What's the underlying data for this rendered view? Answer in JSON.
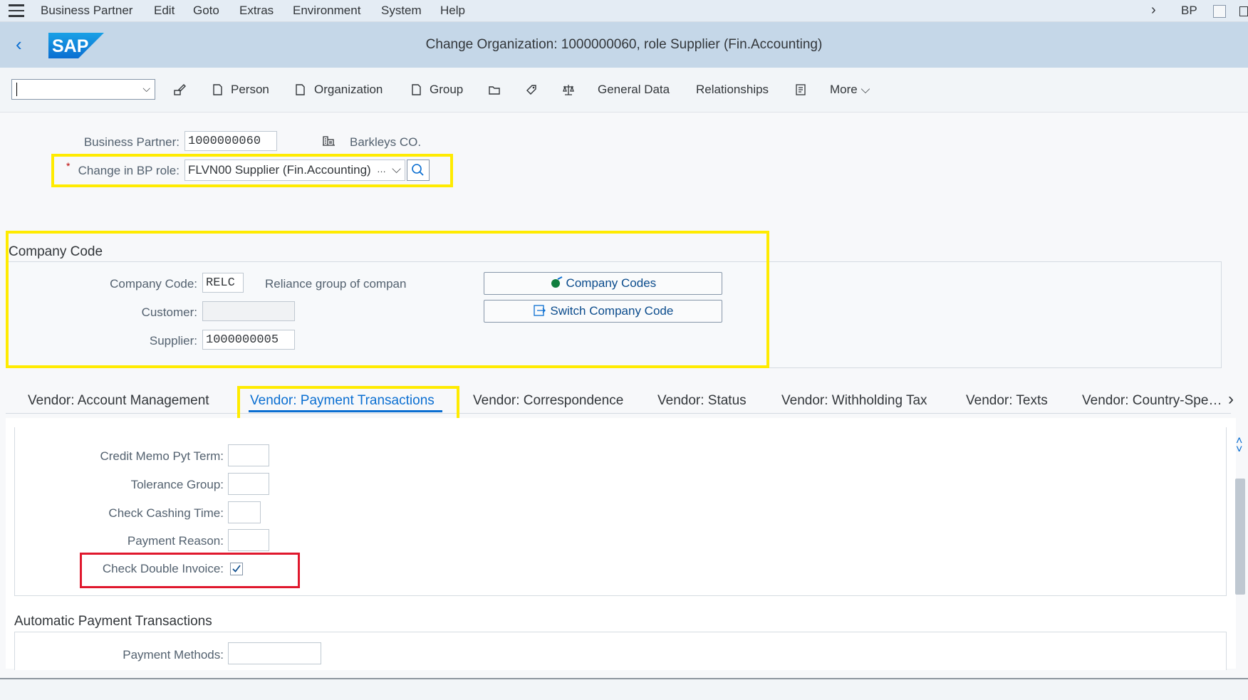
{
  "menu": {
    "items": [
      "Business Partner",
      "Edit",
      "Goto",
      "Extras",
      "Environment",
      "System",
      "Help"
    ],
    "right_label": "BP"
  },
  "header": {
    "title": "Change Organization: 1000000060, role Supplier (Fin.Accounting)",
    "logo_text": "SAP"
  },
  "toolbar": {
    "person": "Person",
    "organization": "Organization",
    "group": "Group",
    "general_data": "General Data",
    "relationships": "Relationships",
    "more": "More"
  },
  "bp": {
    "business_partner_label": "Business Partner:",
    "business_partner_value": "1000000060",
    "partner_name": "Barkleys CO.",
    "role_label": "Change in BP role:",
    "role_required_mark": "*",
    "role_value": "FLVN00 Supplier (Fin.Accounting)",
    "role_ellipsis": "…"
  },
  "company_code": {
    "section_title": "Company Code",
    "company_code_label": "Company Code:",
    "company_code_value": "RELC",
    "company_code_desc": "Reliance group of compan",
    "customer_label": "Customer:",
    "customer_value": "",
    "supplier_label": "Supplier:",
    "supplier_value": "1000000005",
    "company_codes_button": "Company Codes",
    "switch_company_code_button": "Switch Company Code"
  },
  "tabs": [
    "Vendor: Account Management",
    "Vendor: Payment Transactions",
    "Vendor: Correspondence",
    "Vendor: Status",
    "Vendor: Withholding Tax",
    "Vendor: Texts",
    "Vendor: Country-Spe…"
  ],
  "payment": {
    "credit_memo_label": "Credit Memo Pyt Term:",
    "credit_memo_value": "",
    "tolerance_group_label": "Tolerance Group:",
    "tolerance_group_value": "",
    "check_cashing_label": "Check Cashing Time:",
    "check_cashing_value": "",
    "payment_reason_label": "Payment Reason:",
    "payment_reason_value": "",
    "check_double_invoice_label": "Check Double Invoice:",
    "check_double_invoice_checked": true
  },
  "automatic": {
    "section_title": "Automatic Payment Transactions",
    "payment_methods_label": "Payment Methods:",
    "payment_methods_value": ""
  },
  "colors": {
    "header_bg": "#c5d7e8",
    "accent": "#0a6ed1",
    "highlight_yellow": "#ffeb00",
    "highlight_red": "#e0182d"
  }
}
